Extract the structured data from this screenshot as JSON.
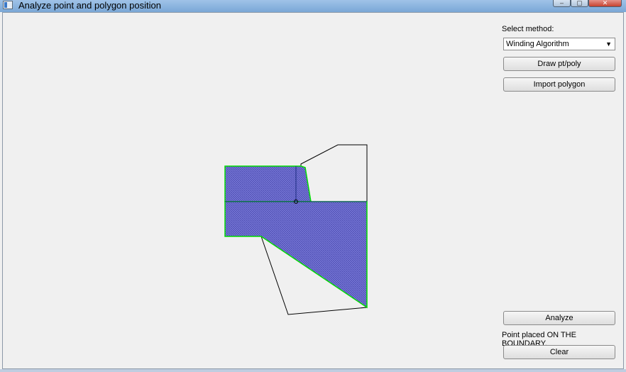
{
  "window": {
    "title": "Analyze point and polygon position"
  },
  "controls": {
    "method_label": "Select method:",
    "method_selected": "Winding Algorithm",
    "draw_button": "Draw pt/poly",
    "import_button": "Import polygon",
    "analyze_button": "Analyze",
    "status_text": "Point placed ON THE BOUNDARY.",
    "clear_button": "Clear"
  },
  "colors": {
    "highlight_fill": "#6666cc",
    "highlight_stroke": "#00dd00",
    "outline": "#000000"
  }
}
